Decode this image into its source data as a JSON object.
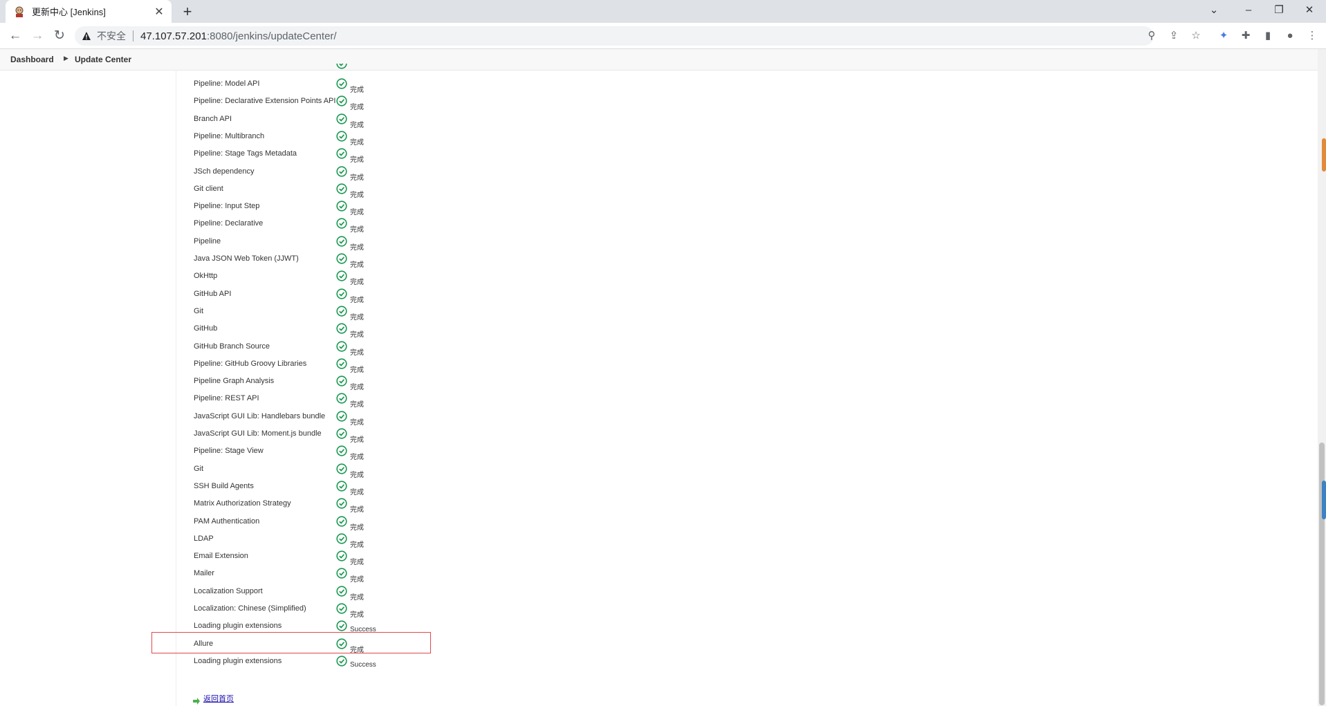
{
  "browser": {
    "tab_title": "更新中心 [Jenkins]",
    "insecure_label": "不安全",
    "url_host": "47.107.57.201",
    "url_rest": ":8080/jenkins/updateCenter/"
  },
  "breadcrumb": {
    "items": [
      "Dashboard",
      "Update Center"
    ]
  },
  "plugins": [
    {
      "name": "Pipeline: Model API",
      "status": "完成"
    },
    {
      "name": "Pipeline: Declarative Extension Points API",
      "status": "完成"
    },
    {
      "name": "Branch API",
      "status": "完成"
    },
    {
      "name": "Pipeline: Multibranch",
      "status": "完成"
    },
    {
      "name": "Pipeline: Stage Tags Metadata",
      "status": "完成"
    },
    {
      "name": "JSch dependency",
      "status": "完成"
    },
    {
      "name": "Git client",
      "status": "完成"
    },
    {
      "name": "Pipeline: Input Step",
      "status": "完成"
    },
    {
      "name": "Pipeline: Declarative",
      "status": "完成"
    },
    {
      "name": "Pipeline",
      "status": "完成"
    },
    {
      "name": "Java JSON Web Token (JJWT)",
      "status": "完成"
    },
    {
      "name": "OkHttp",
      "status": "完成"
    },
    {
      "name": "GitHub API",
      "status": "完成"
    },
    {
      "name": "Git",
      "status": "完成"
    },
    {
      "name": "GitHub",
      "status": "完成"
    },
    {
      "name": "GitHub Branch Source",
      "status": "完成"
    },
    {
      "name": "Pipeline: GitHub Groovy Libraries",
      "status": "完成"
    },
    {
      "name": "Pipeline Graph Analysis",
      "status": "完成"
    },
    {
      "name": "Pipeline: REST API",
      "status": "完成"
    },
    {
      "name": "JavaScript GUI Lib: Handlebars bundle",
      "status": "完成"
    },
    {
      "name": "JavaScript GUI Lib: Moment.js bundle",
      "status": "完成"
    },
    {
      "name": "Pipeline: Stage View",
      "status": "完成"
    },
    {
      "name": "Git",
      "status": "完成"
    },
    {
      "name": "SSH Build Agents",
      "status": "完成"
    },
    {
      "name": "Matrix Authorization Strategy",
      "status": "完成"
    },
    {
      "name": "PAM Authentication",
      "status": "完成"
    },
    {
      "name": "LDAP",
      "status": "完成"
    },
    {
      "name": "Email Extension",
      "status": "完成"
    },
    {
      "name": "Mailer",
      "status": "完成"
    },
    {
      "name": "Localization Support",
      "status": "完成"
    },
    {
      "name": "Localization: Chinese (Simplified)",
      "status": "完成"
    },
    {
      "name": "Loading plugin extensions",
      "status": "Success"
    },
    {
      "name": "Allure",
      "status": "完成"
    },
    {
      "name": "Loading plugin extensions",
      "status": "Success"
    }
  ],
  "back_link": "返回首页",
  "colors": {
    "success_green": "#1a9850",
    "highlight_red": "#e0474c"
  }
}
